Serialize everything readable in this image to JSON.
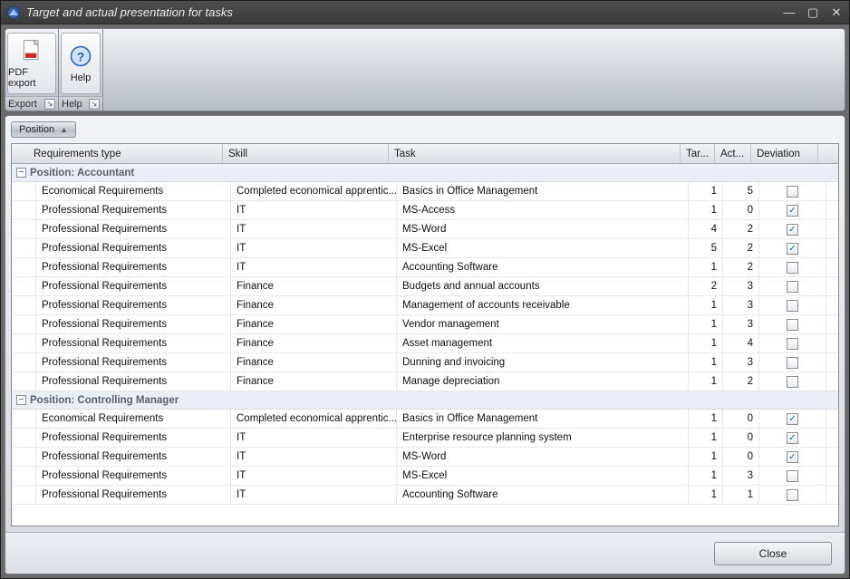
{
  "window": {
    "title": "Target and actual presentation for tasks",
    "min_tooltip": "Minimize",
    "max_tooltip": "Maximize",
    "close_tooltip": "Close"
  },
  "ribbon": {
    "groups": [
      {
        "caption": "Export",
        "buttons": [
          {
            "id": "pdf-export",
            "label": "PDF export",
            "icon": "pdf"
          }
        ]
      },
      {
        "caption": "Help",
        "buttons": [
          {
            "id": "help",
            "label": "Help",
            "icon": "help"
          }
        ]
      }
    ]
  },
  "groupbar": {
    "field": "Position",
    "direction": "asc"
  },
  "grid": {
    "columns": {
      "reqtype": "Requirements type",
      "skill": "Skill",
      "task": "Task",
      "target": "Tar...",
      "actual": "Act...",
      "deviation": "Deviation"
    },
    "groups": [
      {
        "title": "Position: Accountant",
        "rows": [
          {
            "reqtype": "Economical Requirements",
            "skill": "Completed economical apprentic...",
            "task": "Basics in Office Management",
            "tar": 1,
            "act": 5,
            "dev": false
          },
          {
            "reqtype": "Professional Requirements",
            "skill": "IT",
            "task": "MS-Access",
            "tar": 1,
            "act": 0,
            "dev": true
          },
          {
            "reqtype": "Professional Requirements",
            "skill": "IT",
            "task": "MS-Word",
            "tar": 4,
            "act": 2,
            "dev": true
          },
          {
            "reqtype": "Professional Requirements",
            "skill": "IT",
            "task": "MS-Excel",
            "tar": 5,
            "act": 2,
            "dev": true
          },
          {
            "reqtype": "Professional Requirements",
            "skill": "IT",
            "task": "Accounting Software",
            "tar": 1,
            "act": 2,
            "dev": false
          },
          {
            "reqtype": "Professional Requirements",
            "skill": "Finance",
            "task": "Budgets and annual accounts",
            "tar": 2,
            "act": 3,
            "dev": false
          },
          {
            "reqtype": "Professional Requirements",
            "skill": "Finance",
            "task": "Management of accounts receivable",
            "tar": 1,
            "act": 3,
            "dev": false
          },
          {
            "reqtype": "Professional Requirements",
            "skill": "Finance",
            "task": "Vendor management",
            "tar": 1,
            "act": 3,
            "dev": false
          },
          {
            "reqtype": "Professional Requirements",
            "skill": "Finance",
            "task": "Asset management",
            "tar": 1,
            "act": 4,
            "dev": false
          },
          {
            "reqtype": "Professional Requirements",
            "skill": "Finance",
            "task": "Dunning and invoicing",
            "tar": 1,
            "act": 3,
            "dev": false
          },
          {
            "reqtype": "Professional Requirements",
            "skill": "Finance",
            "task": "Manage depreciation",
            "tar": 1,
            "act": 2,
            "dev": false
          }
        ]
      },
      {
        "title": "Position: Controlling Manager",
        "rows": [
          {
            "reqtype": "Economical Requirements",
            "skill": "Completed economical apprentic...",
            "task": "Basics in Office Management",
            "tar": 1,
            "act": 0,
            "dev": true
          },
          {
            "reqtype": "Professional Requirements",
            "skill": "IT",
            "task": "Enterprise resource planning system",
            "tar": 1,
            "act": 0,
            "dev": true
          },
          {
            "reqtype": "Professional Requirements",
            "skill": "IT",
            "task": "MS-Word",
            "tar": 1,
            "act": 0,
            "dev": true
          },
          {
            "reqtype": "Professional Requirements",
            "skill": "IT",
            "task": "MS-Excel",
            "tar": 1,
            "act": 3,
            "dev": false
          },
          {
            "reqtype": "Professional Requirements",
            "skill": "IT",
            "task": "Accounting Software",
            "tar": 1,
            "act": 1,
            "dev": false
          }
        ]
      }
    ]
  },
  "footer": {
    "close": "Close"
  },
  "icons": {
    "expander_minus": "−",
    "sort_asc": "▲",
    "launcher": "↘",
    "check": "✓"
  }
}
